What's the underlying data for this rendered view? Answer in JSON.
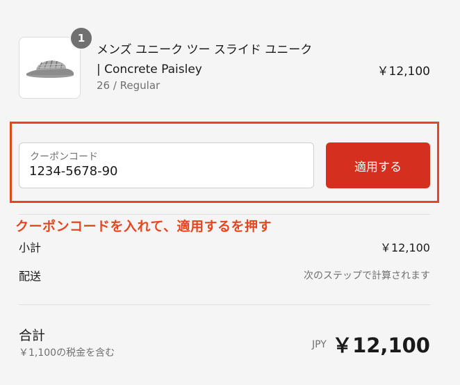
{
  "product": {
    "quantity": "1",
    "name_line1": "メンズ ユニーク ツー スライド ユニーク",
    "name_line2": "| Concrete Paisley",
    "variant": "26 / Regular",
    "price": "￥12,100",
    "image_icon": "sandal-image"
  },
  "coupon": {
    "label": "クーポンコード",
    "value": "1234-5678-90",
    "apply_label": "適用する",
    "highlight_color": "#e6461f",
    "button_color": "#d5301f"
  },
  "annotation": "クーポンコードを入れて、適用するを押す",
  "summary": {
    "subtotal_label": "小計",
    "subtotal_value": "￥12,100",
    "shipping_label": "配送",
    "shipping_value": "次のステップで計算されます",
    "total_label": "合計",
    "tax_note": "￥1,100の税金を含む",
    "currency": "JPY",
    "total_value": "￥12,100"
  }
}
